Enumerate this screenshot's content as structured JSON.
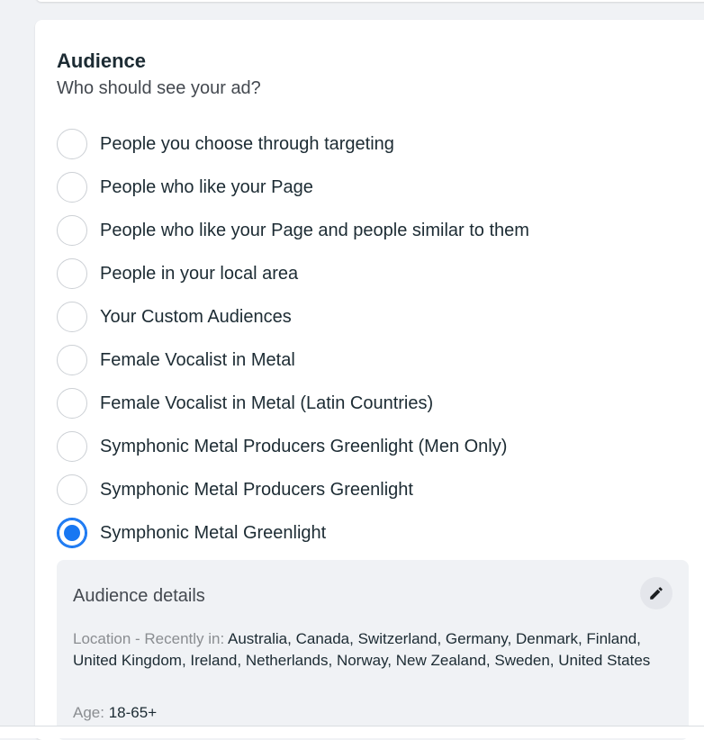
{
  "audience": {
    "title": "Audience",
    "subtitle": "Who should see your ad?",
    "options": [
      {
        "label": "People you choose through targeting",
        "selected": false
      },
      {
        "label": "People who like your Page",
        "selected": false
      },
      {
        "label": "People who like your Page and people similar to them",
        "selected": false
      },
      {
        "label": "People in your local area",
        "selected": false
      },
      {
        "label": "Your Custom Audiences",
        "selected": false
      },
      {
        "label": "Female Vocalist in Metal",
        "selected": false
      },
      {
        "label": "Female Vocalist in Metal (Latin Countries)",
        "selected": false
      },
      {
        "label": "Symphonic Metal Producers Greenlight (Men Only)",
        "selected": false
      },
      {
        "label": "Symphonic Metal Producers Greenlight",
        "selected": false
      },
      {
        "label": "Symphonic Metal Greenlight",
        "selected": true
      }
    ]
  },
  "details": {
    "title": "Audience details",
    "edit_icon": "pencil-icon",
    "location_prefix": "Location - Recently in:",
    "location_value": "Australia, Canada, Switzerland, Germany, Denmark, Finland, United Kingdom, Ireland, Netherlands, Norway, New Zealand, Sweden, United States",
    "age_prefix": "Age:",
    "age_value": "18-65+"
  },
  "colors": {
    "accent": "#1877f2",
    "page_bg": "#f0f2f5",
    "card_bg": "#ffffff"
  }
}
